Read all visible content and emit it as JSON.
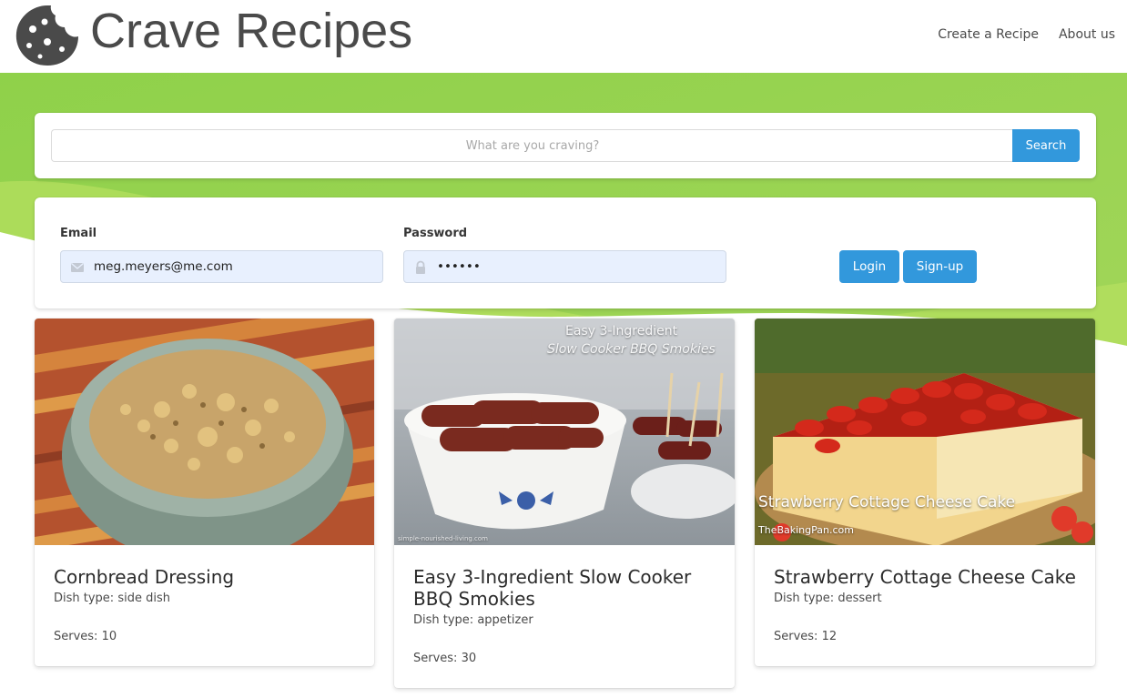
{
  "brand": {
    "title": "Crave Recipes",
    "logo_icon": "cookie-icon"
  },
  "nav": {
    "items": [
      {
        "label": "Create a Recipe"
      },
      {
        "label": "About us"
      }
    ]
  },
  "colors": {
    "accent": "#3298dc",
    "hero_green": "#9ad44e"
  },
  "search": {
    "placeholder": "What are you craving?",
    "value": "",
    "button_label": "Search"
  },
  "login": {
    "email_label": "Email",
    "email_value": "meg.meyers@me.com",
    "email_icon": "envelope-icon",
    "password_label": "Password",
    "password_value": "••••••",
    "password_icon": "lock-icon",
    "login_button": "Login",
    "signup_button": "Sign-up"
  },
  "recipes": [
    {
      "title": "Cornbread Dressing",
      "dish_type": "Dish type: side dish",
      "serves": "Serves: 10",
      "image": "cornbread-dressing-photo"
    },
    {
      "title": "Easy 3-Ingredient Slow Cooker BBQ Smokies",
      "dish_type": "Dish type: appetizer",
      "serves": "Serves: 30",
      "image": "bbq-smokies-photo",
      "image_caption_line1": "Easy 3-Ingredient",
      "image_caption_line2": "Slow Cooker BBQ Smokies",
      "image_credit": "simple-nourished-living.com"
    },
    {
      "title": "Strawberry Cottage Cheese Cake",
      "dish_type": "Dish type: dessert",
      "serves": "Serves: 12",
      "image": "strawberry-cheesecake-photo",
      "image_caption": "Strawberry Cottage Cheese Cake",
      "image_credit": "TheBakingPan.com"
    }
  ]
}
